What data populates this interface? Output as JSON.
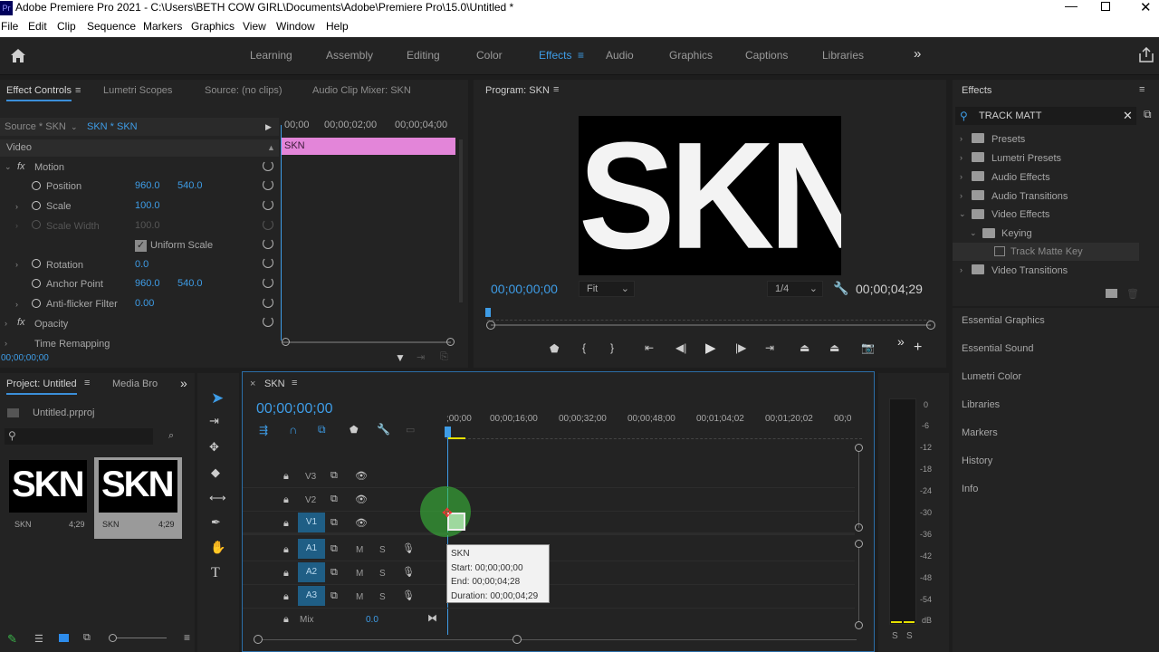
{
  "app": {
    "title": "Adobe Premiere Pro 2021 - C:\\Users\\BETH COW GIRL\\Documents\\Adobe\\Premiere Pro\\15.0\\Untitled *",
    "icon": "Pr"
  },
  "menu": [
    "File",
    "Edit",
    "Clip",
    "Sequence",
    "Markers",
    "Graphics",
    "View",
    "Window",
    "Help"
  ],
  "workspaces": [
    "Learning",
    "Assembly",
    "Editing",
    "Color",
    "Effects",
    "Audio",
    "Graphics",
    "Captions",
    "Libraries"
  ],
  "effect_controls": {
    "tabs": [
      "Effect Controls",
      "Lumetri Scopes",
      "Source: (no clips)",
      "Audio Clip Mixer: SKN"
    ],
    "source": "Source * SKN",
    "clip": "SKN * SKN",
    "ruler": [
      "00;00",
      "00;00;02;00",
      "00;00;04;00"
    ],
    "clip_bar": "SKN",
    "video": "Video",
    "motion": "Motion",
    "fx": "fx",
    "position": {
      "label": "Position",
      "x": "960.0",
      "y": "540.0"
    },
    "scale": {
      "label": "Scale",
      "value": "100.0"
    },
    "scale_width": {
      "label": "Scale Width",
      "value": "100.0"
    },
    "uniform": "Uniform Scale",
    "rotation": {
      "label": "Rotation",
      "value": "0.0"
    },
    "anchor": {
      "label": "Anchor Point",
      "x": "960.0",
      "y": "540.0"
    },
    "flicker": {
      "label": "Anti-flicker Filter",
      "value": "0.00"
    },
    "opacity": "Opacity",
    "remap": "Time Remapping",
    "timecode": "00;00;00;00"
  },
  "program": {
    "title": "Program: SKN",
    "frame_text": "SKN",
    "timecode": "00;00;00;00",
    "fit": "Fit",
    "quality": "1/4",
    "duration": "00;00;04;29"
  },
  "effects": {
    "title": "Effects",
    "search": "TRACK MATT",
    "tree": [
      {
        "label": "Presets"
      },
      {
        "label": "Lumetri Presets"
      },
      {
        "label": "Audio Effects"
      },
      {
        "label": "Audio Transitions"
      },
      {
        "label": "Video Effects"
      },
      {
        "label": "Keying"
      },
      {
        "label": "Track Matte Key"
      },
      {
        "label": "Video Transitions"
      }
    ]
  },
  "side_panels": [
    "Essential Graphics",
    "Essential Sound",
    "Lumetri Color",
    "Libraries",
    "Markers",
    "History",
    "Info"
  ],
  "project": {
    "tabs": [
      "Project: Untitled",
      "Media Bro"
    ],
    "file": "Untitled.prproj",
    "items": [
      {
        "name": "SKN",
        "dur": "4;29",
        "thumb": "SKN"
      },
      {
        "name": "SKN",
        "dur": "4;29",
        "thumb": "SKN"
      }
    ]
  },
  "timeline": {
    "tab": "SKN",
    "timecode": "00;00;00;00",
    "ruler": [
      ";00;00",
      "00;00;16;00",
      "00;00;32;00",
      "00;00;48;00",
      "00;01;04;02",
      "00;01;20;02",
      "00;0"
    ],
    "video_tracks": [
      "V3",
      "V2",
      "V1"
    ],
    "audio_tracks": [
      "A1",
      "A2",
      "A3"
    ],
    "mix": {
      "label": "Mix",
      "value": "0.0"
    },
    "tooltip": {
      "title": "SKN",
      "start": "Start: 00;00;00;00",
      "end": "End: 00;00;04;28",
      "duration": "Duration: 00;00;04;29"
    },
    "m": "M",
    "s": "S"
  },
  "meter": {
    "scale": [
      "0",
      "-6",
      "-12",
      "-18",
      "-24",
      "-30",
      "-36",
      "-42",
      "-48",
      "-54",
      "dB"
    ],
    "solo": [
      "S",
      "S"
    ]
  },
  "colors": {
    "accent": "#3e9ce6",
    "clip": "#e385d9",
    "track_badge": "#1f5e85"
  }
}
